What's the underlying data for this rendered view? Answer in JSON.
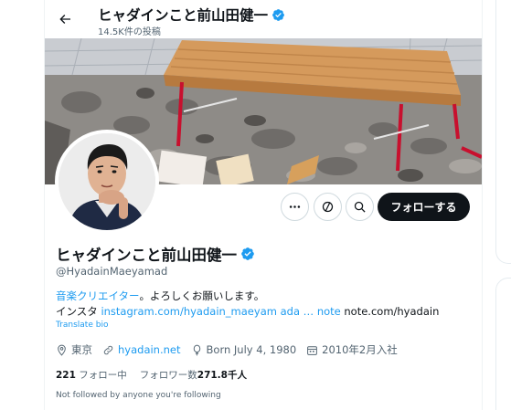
{
  "header": {
    "title": "ヒャダインこと前山田健一",
    "post_count": "14.5K件の投稿"
  },
  "profile": {
    "name": "ヒャダインこと前山田健一",
    "handle": "@HyadainMaeyamad",
    "bio_line1_link": "音楽クリエイター",
    "bio_line1_rest": "。よろしくお願いします。",
    "bio_line2_prefix": "インスタ ",
    "bio_line2_link1": "instagram.com/hyadain_maeyam ada …",
    "bio_line2_link2": "note",
    "bio_line2_rest": " note.com/hyadain",
    "translate": "Translate bio",
    "location": "東京",
    "website": "hyadain.net",
    "born": "Born July 4, 1980",
    "joined": "2010年2月入社",
    "following_count": "221",
    "following_label": " フォロー中",
    "followers_label": "フォロワー数",
    "followers_count": "271.8千人",
    "not_followed": "Not followed by anyone you're following"
  },
  "actions": {
    "follow_label": "フォローする"
  },
  "icons": {
    "back": "back-arrow-icon",
    "verified": "verified-badge-icon",
    "more": "more-icon",
    "subscribe": "subscribe-icon",
    "search": "search-icon",
    "location": "location-icon",
    "link": "link-icon",
    "birthday": "balloon-icon",
    "calendar": "calendar-icon"
  },
  "colors": {
    "accent": "#1d9bf0",
    "text": "#0f1419",
    "muted": "#536471",
    "follow_bg": "#0f1419"
  }
}
